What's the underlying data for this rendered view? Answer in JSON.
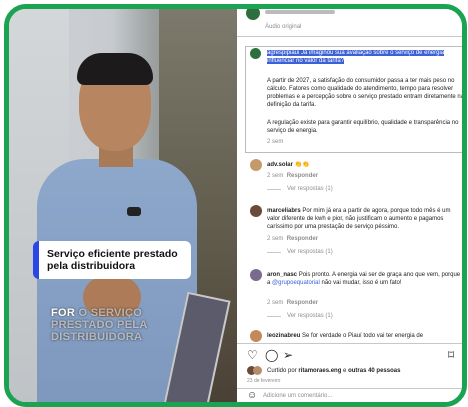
{
  "video": {
    "caption": "Serviço eficiente prestado pela distribuidora",
    "subtitle_main": "FOR",
    "subtitle_dim": "O SERVIÇO PRESTADO PELA DISTRIBUIDORA"
  },
  "post": {
    "header_sub": "Áudio original"
  },
  "main_comment": {
    "username": "agrespipiaui",
    "question": "Já imaginou sua avaliação sobre o serviço de energia influenciar no valor da tarifa?",
    "p1": "A partir de 2027, a satisfação do consumidor passa a ter mais peso no cálculo. Fatores como qualidade do atendimento, tempo para resolver problemas e a percepção sobre o serviço prestado entram diretamente na definição da tarifa.",
    "p2": "A regulação existe para garantir equilíbrio, qualidade e transparência no serviço de energia.",
    "time": "2 sem"
  },
  "comments": [
    {
      "username": "adv.solar",
      "text": "👏👏",
      "time": "2 sem",
      "reply": "Responder",
      "view_replies": "Ver respostas (1)"
    },
    {
      "username": "marceliabrs",
      "text": "Por mim já era a partir de agora, porque todo mês é um valor diferente de kwh e pior, não justificam o aumento e pagamos caríssimo por uma prestação de serviço péssimo.",
      "time": "2 sem",
      "reply": "Responder",
      "view_replies": "Ver respostas (1)"
    },
    {
      "username": "aron_nasc",
      "text_a": "Pois pronto. A energia vai ser de graça ano que vem, porque a ",
      "mention": "@grupoequatorial",
      "text_b": " não vai mudar, isso é um fato!",
      "time": "2 sem",
      "reply": "Responder",
      "view_replies": "Ver respostas (1)"
    },
    {
      "username": "leozinabreu",
      "text": "Se for verdade o Piauí todo vai ter energia de"
    }
  ],
  "likes": {
    "text_pre": "Curtido por ",
    "user": "ritamoraes.eng",
    "text_mid": " e ",
    "others": "outras 40 pessoas",
    "date": "23 de fevereiro"
  },
  "add_comment": {
    "placeholder": "Adicione um comentário..."
  },
  "colors": {
    "frame": "#1aa351",
    "highlight": "#3c60d6",
    "caption_accent": "#2b47e6"
  }
}
